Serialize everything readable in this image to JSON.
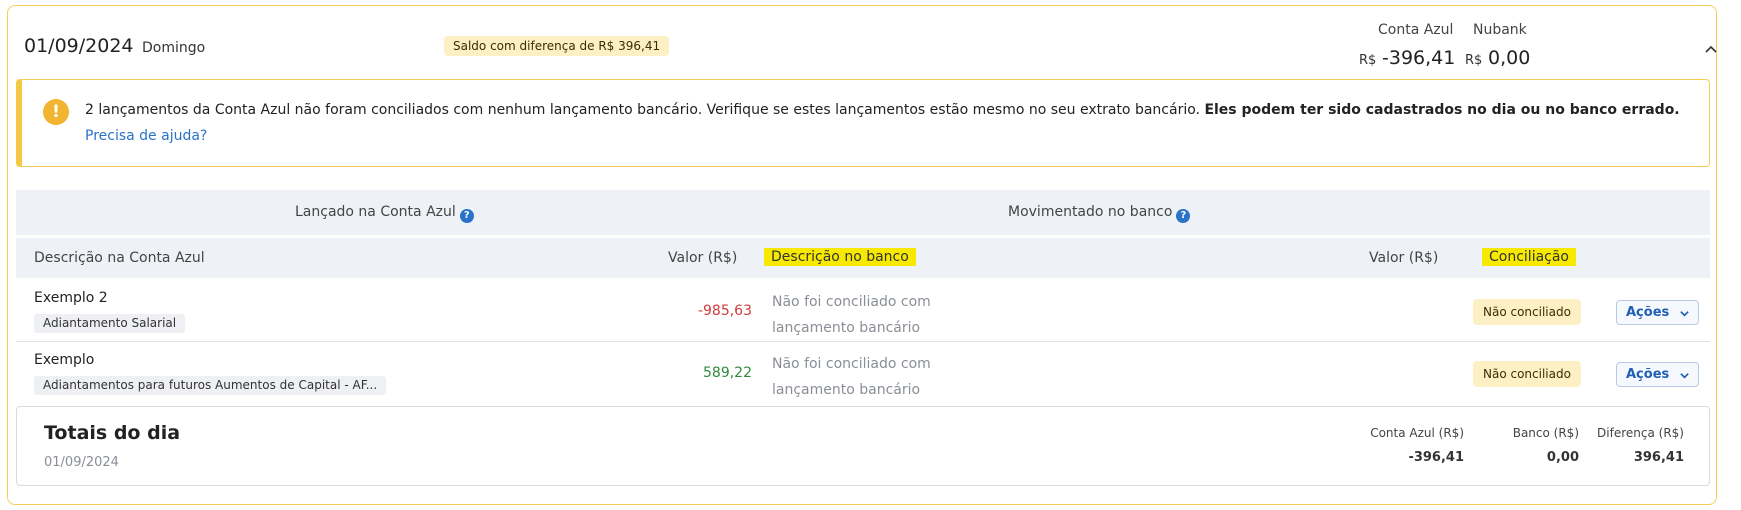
{
  "header": {
    "date": "01/09/2024",
    "weekday": "Domingo",
    "difference_badge": "Saldo com diferença de R$ 396,41",
    "conta_azul_label": "Conta Azul",
    "conta_azul_currency": "R$",
    "conta_azul_value": "-396,41",
    "bank_label": "Nubank",
    "bank_currency": "R$",
    "bank_value": "0,00"
  },
  "warning": {
    "icon": "exclamation-icon",
    "text": "2 lançamentos da Conta Azul não foram conciliados com nenhum lançamento bancário. Verifique se estes lançamentos estão mesmo no seu extrato bancário. ",
    "bold_text": "Eles podem ter sido cadastrados no dia ou no banco errado.",
    "help_link": "Precisa de ajuda?"
  },
  "table": {
    "group_left": "Lançado na Conta Azul",
    "group_right": "Movimentado no banco",
    "columns": {
      "desc_conta_azul": "Descrição na Conta Azul",
      "valor_conta_azul": "Valor (R$)",
      "desc_banco": "Descrição no banco",
      "valor_banco": "Valor (R$)",
      "conciliacao": "Conciliação"
    },
    "rows": [
      {
        "description": "Exemplo 2",
        "category": "Adiantamento Salarial",
        "value": "-985,63",
        "bank_line1": "Não foi conciliado com",
        "bank_line2": "lançamento bancário",
        "status": "Não conciliado",
        "actions": "Ações"
      },
      {
        "description": "Exemplo",
        "category": "Adiantamentos para futuros Aumentos de Capital - AF...",
        "value": "589,22",
        "bank_line1": "Não foi conciliado com",
        "bank_line2": "lançamento bancário",
        "status": "Não conciliado",
        "actions": "Ações"
      }
    ]
  },
  "totals": {
    "title": "Totais do dia",
    "date": "01/09/2024",
    "conta_azul_label": "Conta Azul (R$)",
    "conta_azul_value": "-396,41",
    "banco_label": "Banco (R$)",
    "banco_value": "0,00",
    "diferenca_label": "Diferença (R$)",
    "diferenca_value": "396,41"
  },
  "colors": {
    "accent_border": "#f5cf55",
    "negative": "#d23b3b",
    "positive": "#2e8b3d",
    "link": "#2a73c9",
    "highlight": "#f7ea00"
  }
}
